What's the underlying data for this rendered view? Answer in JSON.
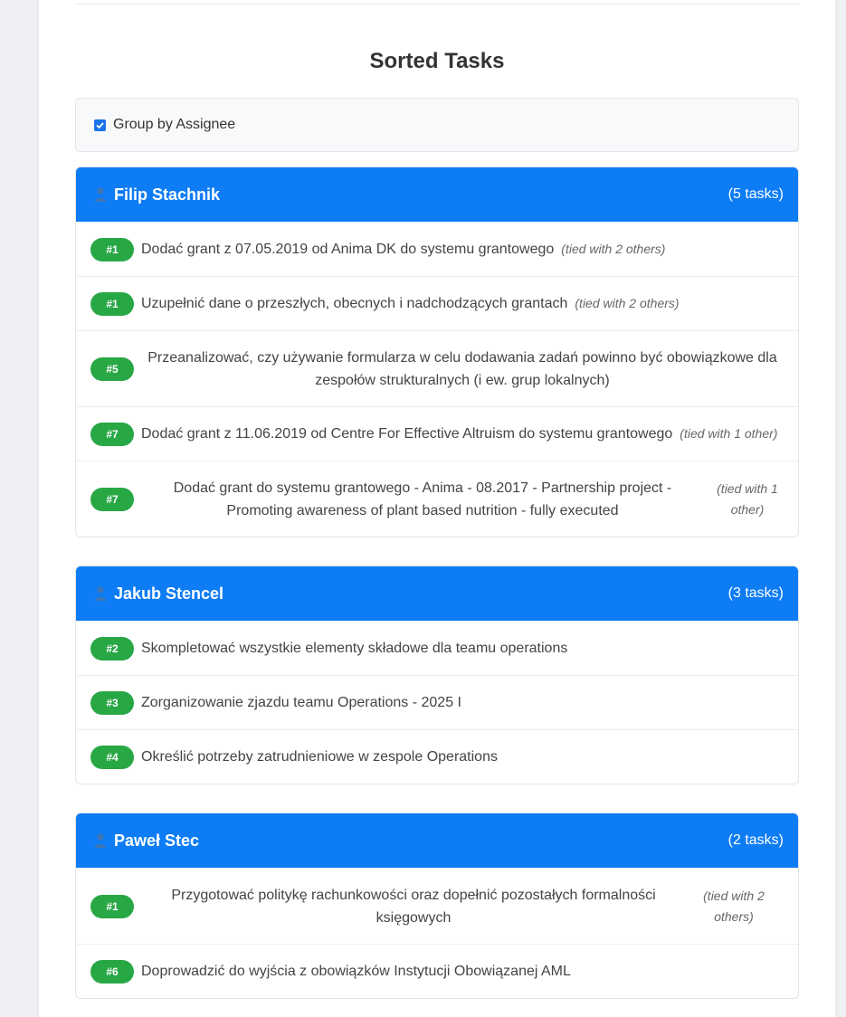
{
  "title": "Sorted Tasks",
  "group_toggle": {
    "label": "Group by Assignee",
    "checked": true
  },
  "groups": [
    {
      "assignee": "Filip Stachnik",
      "count": "(5 tasks)",
      "tasks": [
        {
          "rank": "#1",
          "text": "Dodać grant z 07.05.2019 od Anima DK do systemu grantowego",
          "tie": "(tied with 2 others)"
        },
        {
          "rank": "#1",
          "text": "Uzupełnić dane o przeszłych, obecnych i nadchodzących grantach",
          "tie": "(tied with 2 others)"
        },
        {
          "rank": "#5",
          "text": "Przeanalizować, czy używanie formularza w celu dodawania zadań powinno być obowiązkowe dla zespołów strukturalnych (i ew. grup lokalnych)",
          "tie": ""
        },
        {
          "rank": "#7",
          "text": "Dodać grant z 11.06.2019 od Centre For Effective Altruism do systemu grantowego",
          "tie": "(tied with 1 other)"
        },
        {
          "rank": "#7",
          "text": "Dodać grant do systemu grantowego - Anima - 08.2017 - Partnership project - Promoting awareness of plant based nutrition - fully executed",
          "tie": "(tied with 1 other)"
        }
      ]
    },
    {
      "assignee": "Jakub Stencel",
      "count": "(3 tasks)",
      "tasks": [
        {
          "rank": "#2",
          "text": "Skompletować wszystkie elementy składowe dla teamu operations",
          "tie": ""
        },
        {
          "rank": "#3",
          "text": "Zorganizowanie zjazdu teamu Operations - 2025 I",
          "tie": ""
        },
        {
          "rank": "#4",
          "text": "Określić potrzeby zatrudnieniowe w zespole Operations",
          "tie": ""
        }
      ]
    },
    {
      "assignee": "Paweł Stec",
      "count": "(2 tasks)",
      "tasks": [
        {
          "rank": "#1",
          "text": "Przygotować politykę rachunkowości oraz dopełnić pozostałych formalności księgowych",
          "tie": "(tied with 2 others)"
        },
        {
          "rank": "#6",
          "text": "Doprowadzić do wyjścia z obowiązków Instytucji Obowiązanej AML",
          "tie": ""
        }
      ]
    }
  ]
}
